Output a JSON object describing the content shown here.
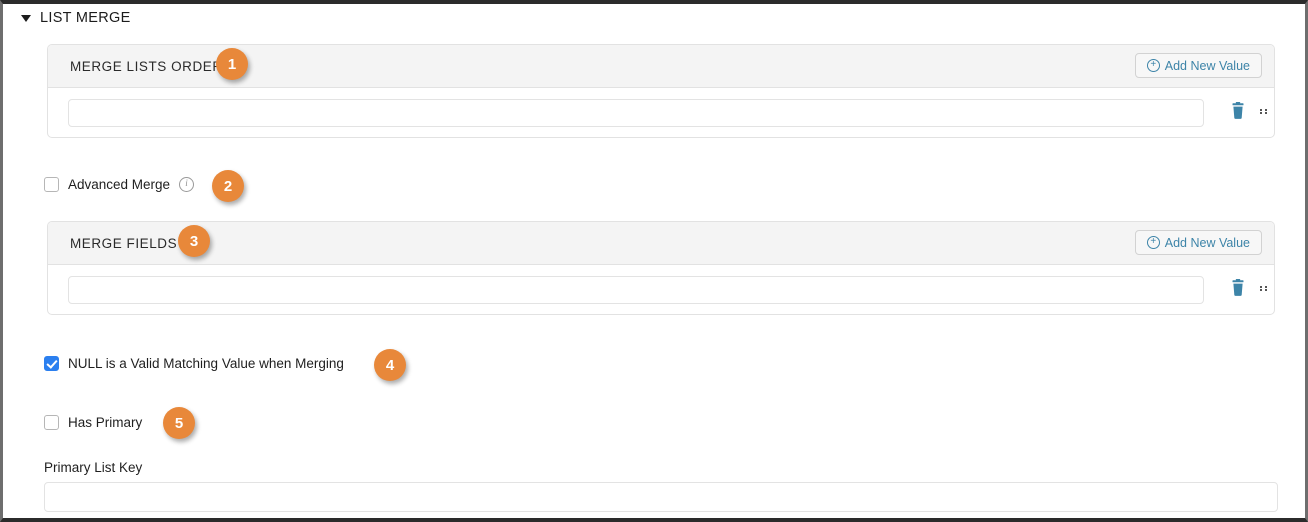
{
  "section": {
    "title": "LIST MERGE",
    "caret_icon": "caret-down-icon",
    "expanded": true
  },
  "colors": {
    "badge_orange": "#E8883A",
    "link_blue": "#3D84A8",
    "checkbox_blue": "#2B7FEF",
    "card_header_gray": "#F4F4F4",
    "border_gray": "#E2E2E2",
    "outer_border_dark": "#2B2B2B"
  },
  "cards": [
    {
      "title": "MERGE LISTS ORDER",
      "add_button": {
        "label": "Add New Value",
        "icon": "plus-circle-icon"
      },
      "row": {
        "input_value": "",
        "input_placeholder": "",
        "delete_icon": "trash-icon",
        "drag_icon": "drag-handle-icon"
      }
    },
    {
      "title": "MERGE FIELDS",
      "add_button": {
        "label": "Add New Value",
        "icon": "plus-circle-icon"
      },
      "row": {
        "input_value": "",
        "input_placeholder": "",
        "delete_icon": "trash-icon",
        "drag_icon": "drag-handle-icon"
      }
    }
  ],
  "checkboxes": [
    {
      "label": "Advanced Merge",
      "checked": false,
      "has_info_icon": true,
      "info_icon": "info-circle-icon",
      "info_glyph": "i"
    },
    {
      "label": "NULL is a Valid Matching Value when Merging",
      "checked": true,
      "has_info_icon": false
    },
    {
      "label": "Has Primary",
      "checked": false,
      "has_info_icon": false
    }
  ],
  "primary_list_key": {
    "label": "Primary List Key",
    "value": "",
    "placeholder": ""
  },
  "badges": [
    {
      "number": "1"
    },
    {
      "number": "2"
    },
    {
      "number": "3"
    },
    {
      "number": "4"
    },
    {
      "number": "5"
    }
  ]
}
